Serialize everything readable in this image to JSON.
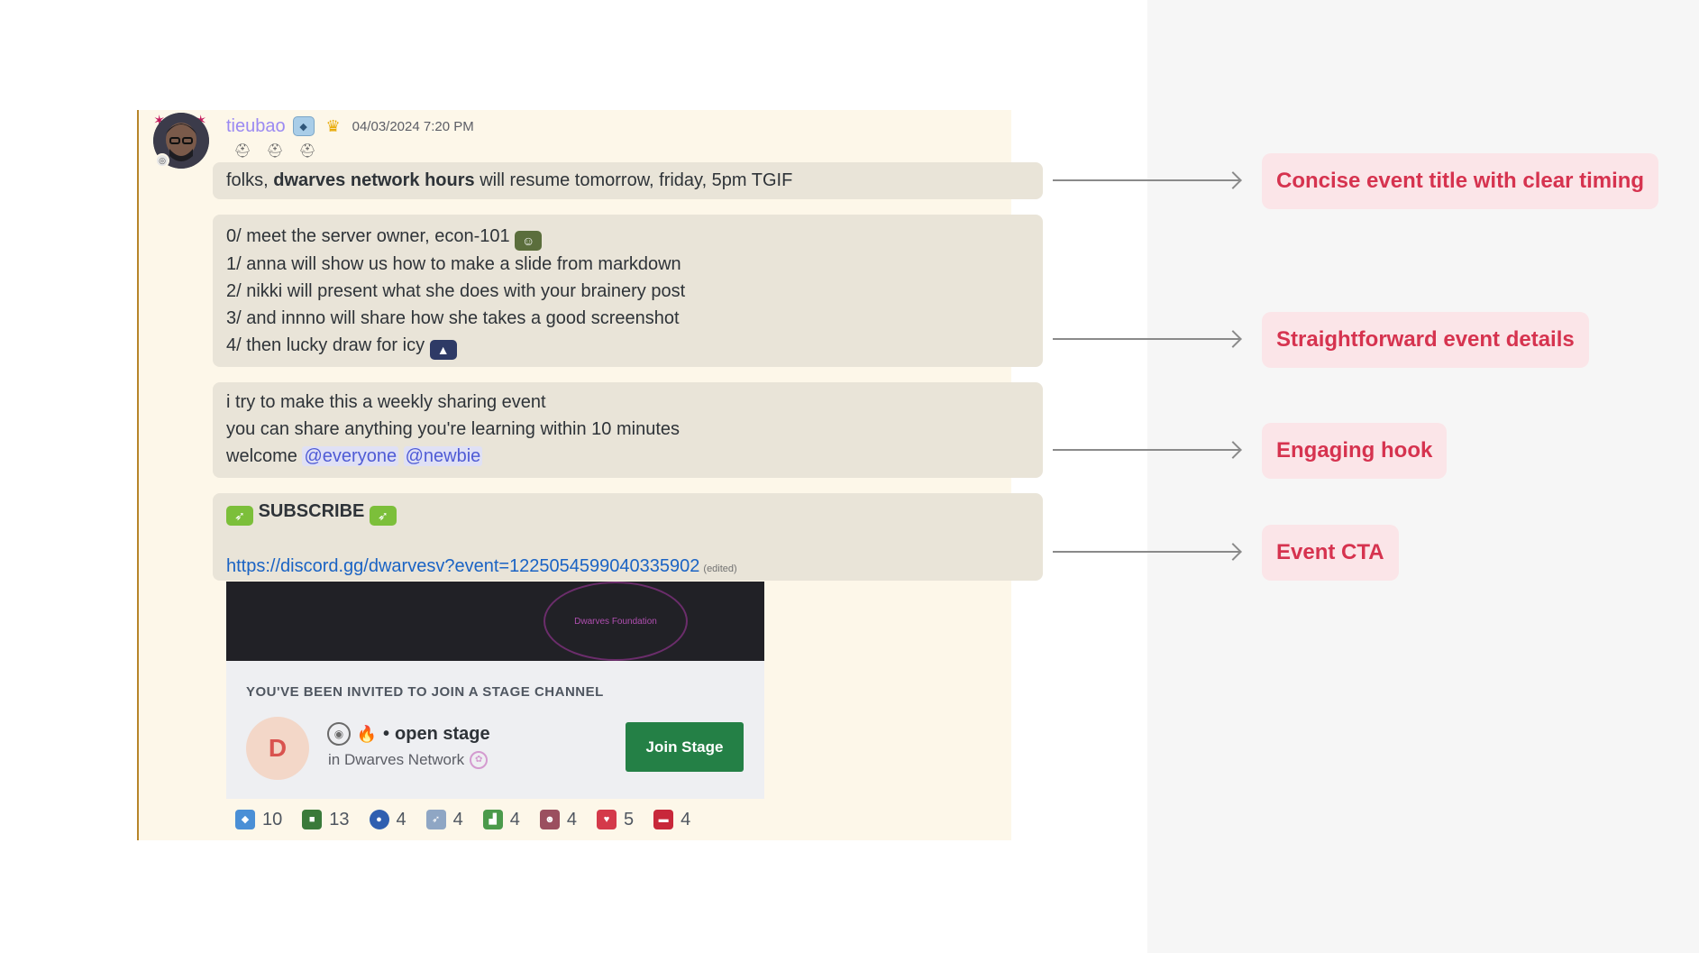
{
  "message": {
    "username": "tieubao",
    "timestamp": "04/03/2024 7:20 PM",
    "icons": {
      "avatar": "avatar-illustration",
      "server_tag": "ice-cube-icon",
      "crown": "crown-icon",
      "badges": [
        "badge-icon",
        "badge-icon",
        "badge-icon"
      ]
    },
    "block1": {
      "prefix": "folks, ",
      "bold": "dwarves network hours",
      "suffix": " will resume tomorrow, friday, 5pm TGIF"
    },
    "block2": {
      "lines": [
        "0/ meet the server owner, econ-101",
        "1/ anna will show us how to make a slide from markdown",
        "2/ nikki will present what she does with your brainery post",
        "3/ and innno will share how she takes a good screenshot",
        "4/ then lucky draw for icy"
      ]
    },
    "block3": {
      "line1": "i try to make this a weekly sharing event",
      "line2": "you can share anything you're learning within 10 minutes",
      "welcome": "welcome",
      "mention1": "@everyone",
      "mention2": "@newbie"
    },
    "block4": {
      "subscribe": "SUBSCRIBE",
      "link": "https://discord.gg/dwarvesv?event=1225054599040335902",
      "edited": "(edited)"
    },
    "invite": {
      "banner_text": "Dwarves Foundation",
      "title": "YOU'VE BEEN INVITED TO JOIN A STAGE CHANNEL",
      "separator": "•",
      "channel": "open stage",
      "server": "in Dwarves Network",
      "button": "Join Stage"
    },
    "reactions": [
      {
        "icon": "ice-cube-emoji",
        "count": "10",
        "color": "#4a8fd6"
      },
      {
        "icon": "gift-emoji",
        "count": "13",
        "color": "#3a7a3a"
      },
      {
        "icon": "globe-emoji",
        "count": "4",
        "color": "#2f5fb0"
      },
      {
        "icon": "rocket-emoji",
        "count": "4",
        "color": "#8fa6c4"
      },
      {
        "icon": "chart-emoji",
        "count": "4",
        "color": "#4b9a4b"
      },
      {
        "icon": "portrait-emoji",
        "count": "4",
        "color": "#9b4f5f"
      },
      {
        "icon": "heart-emoji",
        "count": "5",
        "color": "#d43a4a"
      },
      {
        "icon": "car-emoji",
        "count": "4",
        "color": "#c8283a"
      }
    ]
  },
  "callouts": [
    {
      "label": "Concise event title with clear timing"
    },
    {
      "label": "Straightforward event details"
    },
    {
      "label": "Engaging hook"
    },
    {
      "label": "Event CTA"
    }
  ],
  "colors": {
    "callout_text": "#d6334f",
    "callout_bg": "#fbe5e8",
    "join_button": "#248046",
    "username": "#9b8af2",
    "link": "#1a63c4"
  }
}
